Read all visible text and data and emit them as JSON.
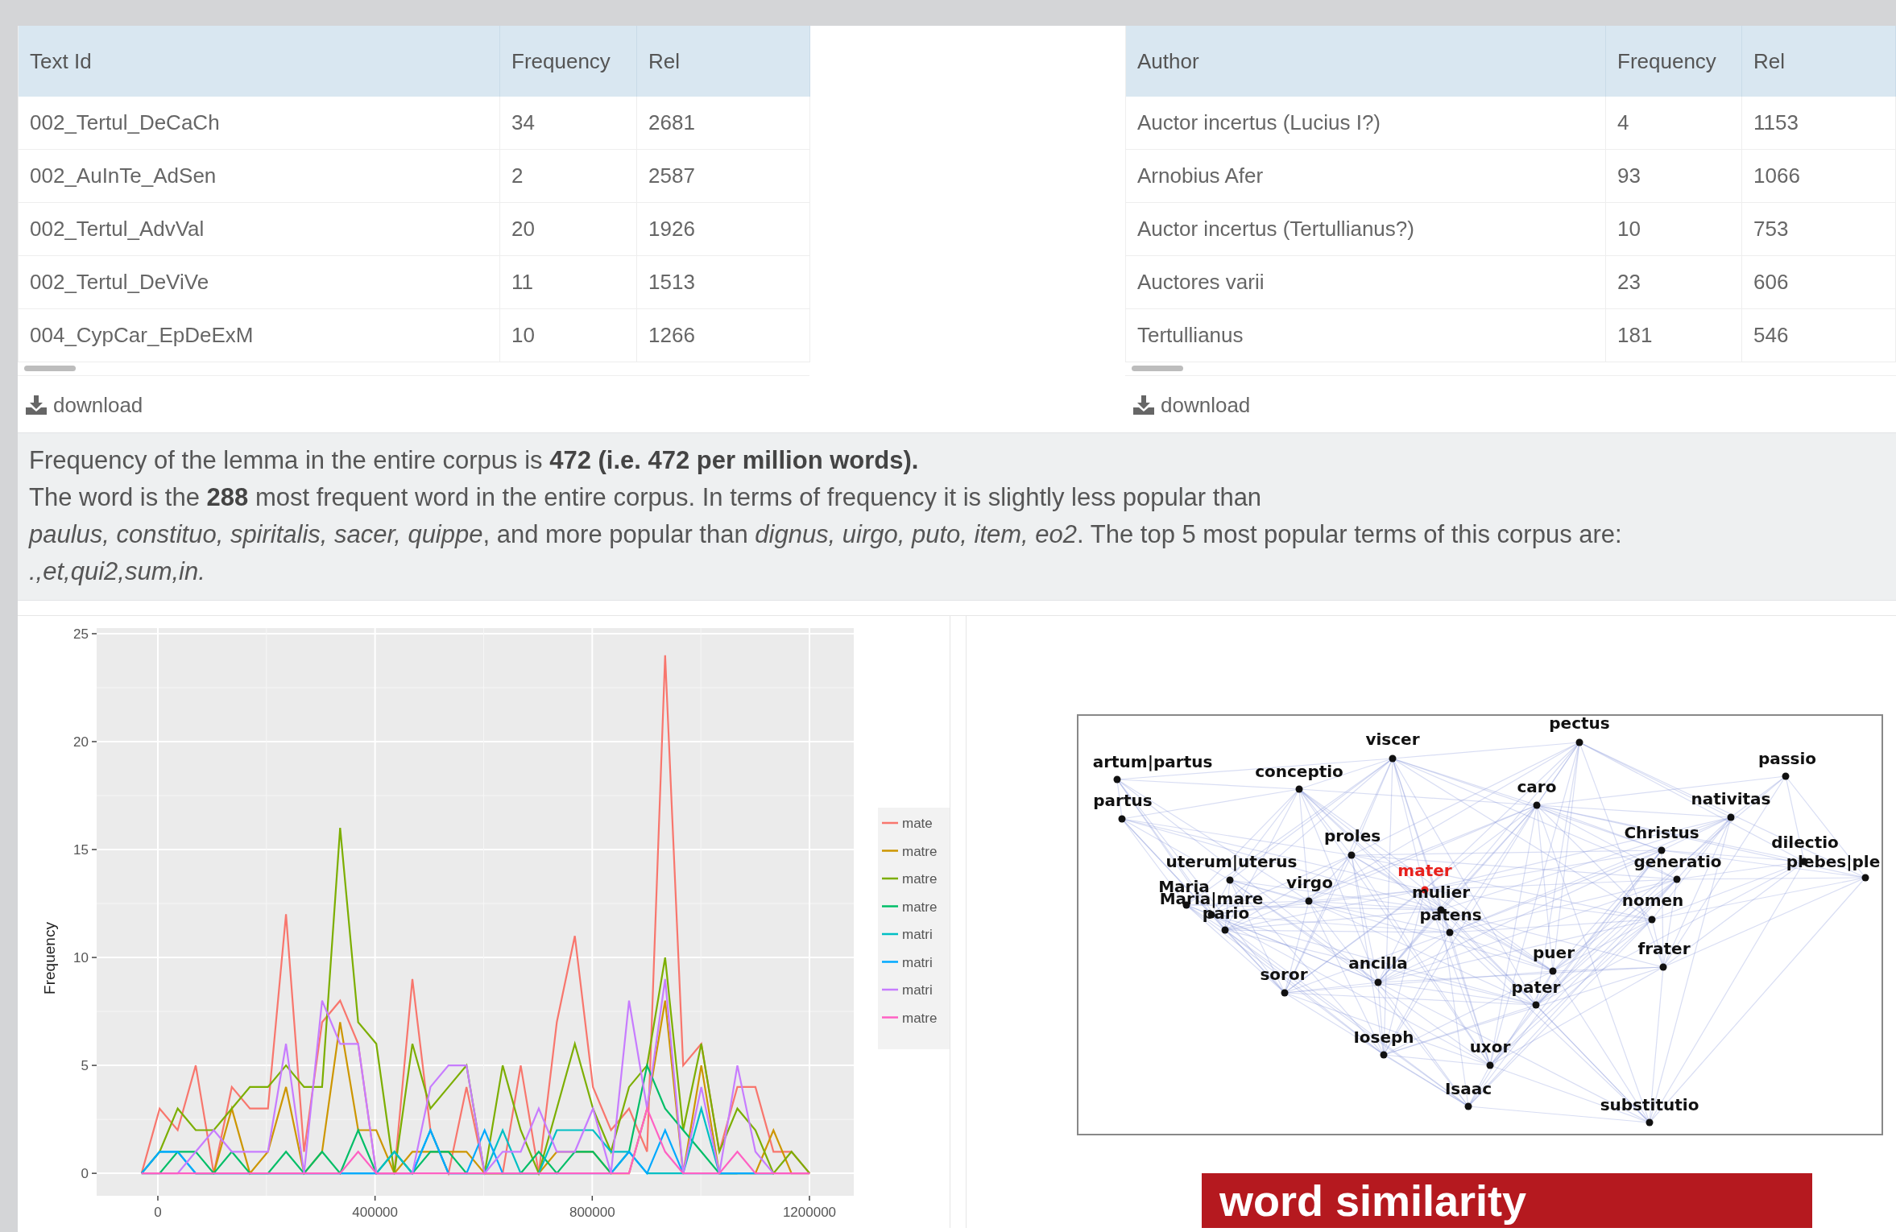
{
  "tables": [
    {
      "columns": [
        "Text Id",
        "Frequency",
        "Rel"
      ],
      "rows": [
        [
          "002_Tertul_DeCaCh",
          "34",
          "2681"
        ],
        [
          "002_AuInTe_AdSen",
          "2",
          "2587"
        ],
        [
          "002_Tertul_AdvVal",
          "20",
          "1926"
        ],
        [
          "002_Tertul_DeViVe",
          "11",
          "1513"
        ],
        [
          "004_CypCar_EpDeExM",
          "10",
          "1266"
        ]
      ],
      "download": "download"
    },
    {
      "columns": [
        "Author",
        "Frequency",
        "Rel"
      ],
      "rows": [
        [
          "Auctor incertus (Lucius I?)",
          "4",
          "1153"
        ],
        [
          "Arnobius Afer",
          "93",
          "1066"
        ],
        [
          "Auctor incertus (Tertullianus?)",
          "10",
          "753"
        ],
        [
          "Auctores varii",
          "23",
          "606"
        ],
        [
          "Tertullianus",
          "181",
          "546"
        ]
      ],
      "download": "download"
    }
  ],
  "summary": [
    "Frequency of the lemma in the entire corpus is **472 (i.e. 472 per million words).**",
    "The word is the **288** most frequent word in the entire corpus. In terms of frequency it is slightly less popular than",
    "*paulus, constituo, spiritalis, sacer, quippe*, and more popular than *dignus, uirgo, puto, item, eo2*. The top 5 most popular terms of this corpus are: *.,et,qui2,sum,in.*"
  ],
  "chart_data": {
    "type": "line",
    "ylabel": "Frequency",
    "x": [
      -30000,
      3250,
      36500,
      69750,
      103000,
      136250,
      169500,
      202750,
      236000,
      269250,
      302500,
      335750,
      369000,
      402250,
      435500,
      468750,
      502000,
      535250,
      568500,
      601750,
      635000,
      668250,
      701500,
      734750,
      768000,
      801250,
      834500,
      867750,
      901000,
      934250,
      967500,
      1000750,
      1034000,
      1067250,
      1100500,
      1133750,
      1167000,
      1200250
    ],
    "xlim": [
      -112700,
      1281600
    ],
    "ylim": [
      -1.04,
      25.26
    ],
    "xticks": [
      0,
      400000,
      800000,
      1200000
    ],
    "grid": true,
    "legend": true,
    "yticks": [
      0,
      5,
      10,
      15,
      20,
      25
    ],
    "series": [
      {
        "name": "mate",
        "color": "#f8766d",
        "values": [
          0,
          3,
          2,
          5,
          0,
          4,
          3,
          3,
          12,
          1,
          7,
          8,
          6,
          0,
          0,
          9,
          2,
          0,
          4,
          0,
          0,
          5,
          0,
          7,
          11,
          4,
          2,
          3,
          1,
          24,
          5,
          6,
          1,
          4,
          4,
          1,
          1,
          0
        ]
      },
      {
        "name": "matre",
        "color": "#cd9600",
        "values": [
          null,
          null,
          null,
          0,
          0,
          3,
          0,
          1,
          4,
          0,
          1,
          7,
          2,
          2,
          0,
          1,
          1,
          1,
          1,
          0,
          0,
          0,
          0,
          1,
          1,
          1,
          0,
          0,
          3,
          8,
          0,
          5,
          0,
          0,
          0,
          2,
          0,
          0
        ]
      },
      {
        "name": "matre",
        "color": "#7cae00",
        "values": [
          0,
          1,
          3,
          2,
          2,
          3,
          4,
          4,
          5,
          4,
          4,
          16,
          7,
          6,
          0,
          6,
          3,
          4,
          5,
          0,
          5,
          2,
          0,
          3,
          6,
          3,
          1,
          4,
          5,
          10,
          2,
          6,
          1,
          3,
          2,
          0,
          1,
          0
        ]
      },
      {
        "name": "matre",
        "color": "#00be67",
        "values": [
          0,
          0,
          1,
          1,
          0,
          1,
          0,
          0,
          1,
          0,
          1,
          0,
          2,
          0,
          1,
          0,
          1,
          1,
          0,
          0,
          0,
          0,
          1,
          0,
          1,
          1,
          0,
          1,
          5,
          3,
          2,
          1,
          0,
          0,
          null,
          null,
          null,
          null
        ]
      },
      {
        "name": "matri",
        "color": "#00bfc4",
        "values": [
          0,
          1,
          1,
          0,
          0,
          0,
          0,
          0,
          0,
          0,
          0,
          0,
          0,
          0,
          1,
          0,
          2,
          0,
          0,
          0,
          2,
          0,
          0,
          2,
          2,
          2,
          1,
          1,
          0,
          0,
          0,
          3,
          0,
          0,
          0,
          0,
          null,
          null
        ]
      },
      {
        "name": "matri",
        "color": "#00a9ff",
        "values": [
          0,
          1,
          1,
          0,
          0,
          0,
          0,
          0,
          0,
          0,
          0,
          0,
          0,
          0,
          0,
          0,
          2,
          0,
          0,
          2,
          0,
          0,
          0,
          0,
          0,
          0,
          0,
          1,
          0,
          2,
          0,
          0,
          0,
          0,
          0,
          0,
          null,
          null
        ]
      },
      {
        "name": "matri",
        "color": "#c77cff",
        "values": [
          0,
          0,
          0,
          1,
          2,
          1,
          1,
          1,
          6,
          0,
          8,
          6,
          6,
          0,
          0,
          0,
          4,
          5,
          5,
          0,
          1,
          1,
          3,
          1,
          1,
          3,
          0,
          8,
          3,
          9,
          0,
          4,
          0,
          5,
          1,
          0,
          0,
          0
        ]
      },
      {
        "name": "matre",
        "color": "#ff61c3",
        "values": [
          0,
          0,
          0,
          0,
          0,
          0,
          0,
          0,
          0,
          0,
          0,
          0,
          1,
          0,
          0,
          0,
          0,
          0,
          0,
          0,
          0,
          0,
          0,
          0,
          0,
          0,
          0,
          0,
          3,
          1,
          0,
          0,
          0,
          1,
          0,
          0,
          0,
          0
        ]
      }
    ]
  },
  "network": {
    "nodes": [
      {
        "label": "pectus",
        "highlighted": false
      },
      {
        "label": "viscer",
        "highlighted": false
      },
      {
        "label": "artum|partus",
        "highlighted": false
      },
      {
        "label": "conceptio",
        "highlighted": false
      },
      {
        "label": "partus",
        "highlighted": false
      },
      {
        "label": "caro",
        "highlighted": false
      },
      {
        "label": "passio",
        "highlighted": false
      },
      {
        "label": "nativitas",
        "highlighted": false
      },
      {
        "label": "proles",
        "highlighted": false
      },
      {
        "label": "Christus",
        "highlighted": false
      },
      {
        "label": "dilectio",
        "highlighted": false
      },
      {
        "label": "uterum|uterus",
        "highlighted": false
      },
      {
        "label": "generatio",
        "highlighted": false
      },
      {
        "label": "plebes|ple",
        "highlighted": false
      },
      {
        "label": "Maria",
        "highlighted": false
      },
      {
        "label": "Maria|mare",
        "highlighted": false
      },
      {
        "label": "virgo",
        "highlighted": false
      },
      {
        "label": "mater",
        "highlighted": true
      },
      {
        "label": "mulier",
        "highlighted": false
      },
      {
        "label": "pario",
        "highlighted": false
      },
      {
        "label": "patens",
        "highlighted": false
      },
      {
        "label": "nomen",
        "highlighted": false
      },
      {
        "label": "puer",
        "highlighted": false
      },
      {
        "label": "frater",
        "highlighted": false
      },
      {
        "label": "soror",
        "highlighted": false
      },
      {
        "label": "ancilla",
        "highlighted": false
      },
      {
        "label": "pater",
        "highlighted": false
      },
      {
        "label": "Ioseph",
        "highlighted": false
      },
      {
        "label": "uxor",
        "highlighted": false
      },
      {
        "label": "Isaac",
        "highlighted": false
      },
      {
        "label": "substitutio",
        "highlighted": false
      }
    ]
  },
  "banner": {
    "title": "word similarity"
  }
}
